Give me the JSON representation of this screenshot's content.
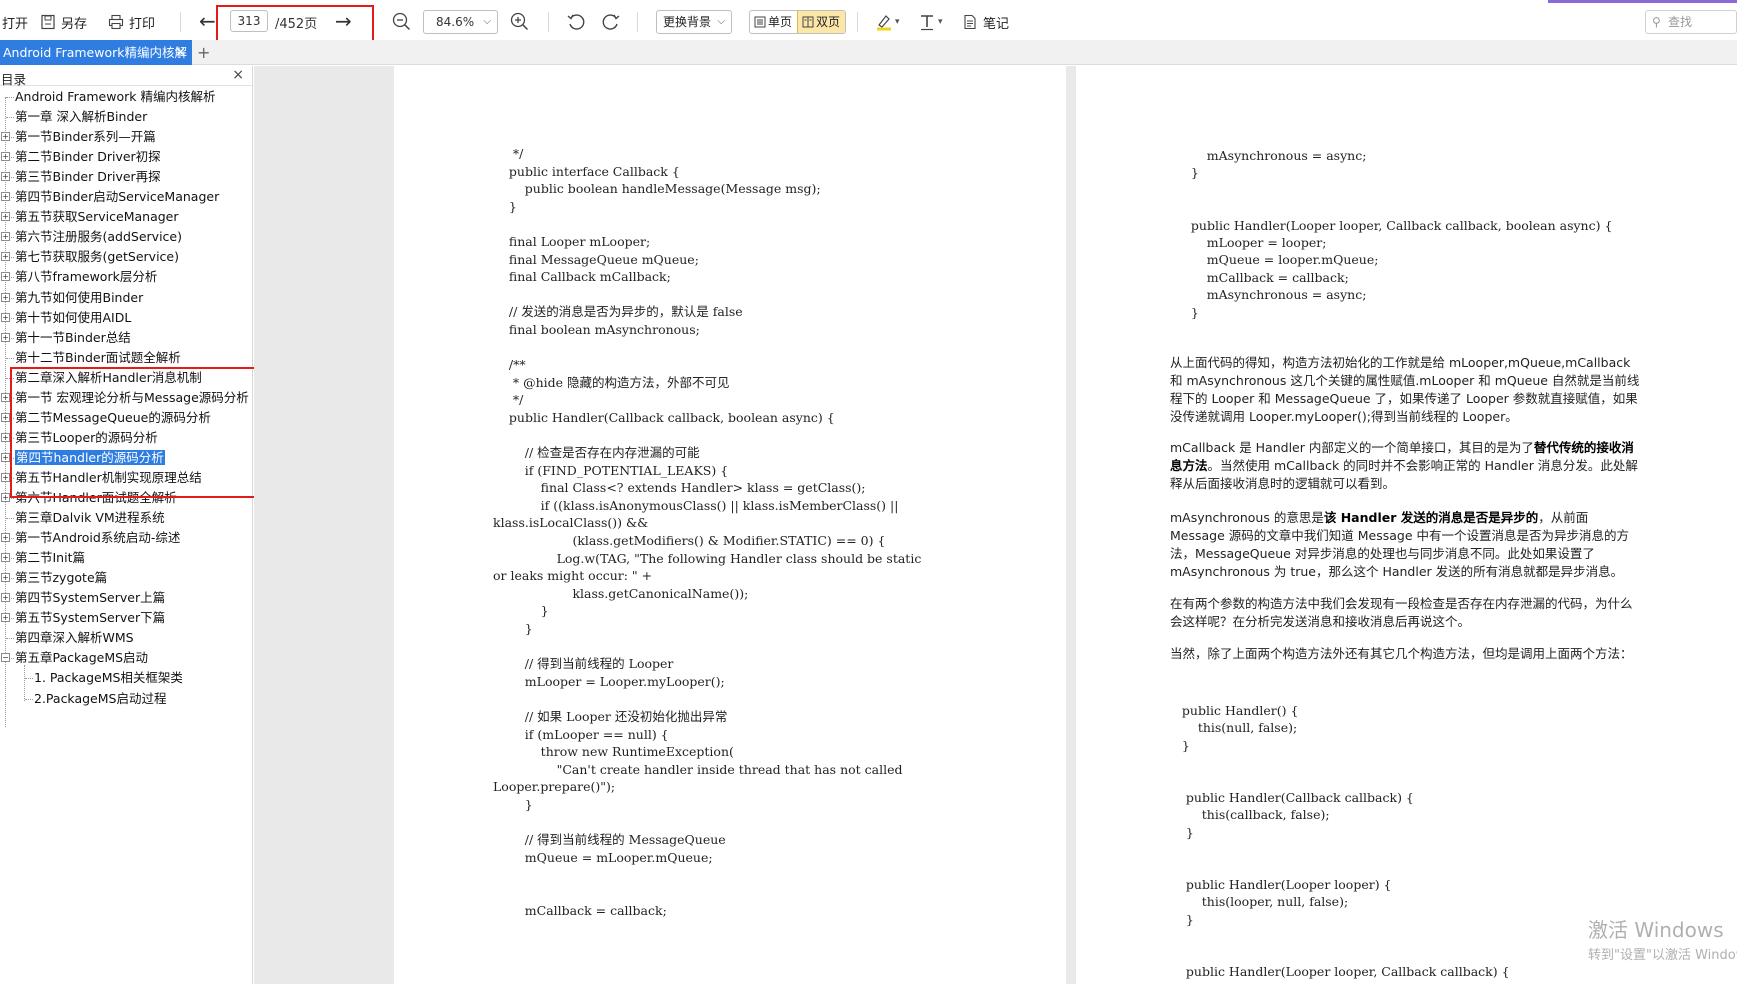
{
  "toolbar": {
    "open": "打开",
    "save_as": "另存",
    "print": "打印",
    "page_current": "313",
    "page_total": "/452页",
    "zoom": "84.6%",
    "background": "更换背景",
    "single_page": "单页",
    "double_page": "双页",
    "note": "笔记",
    "search_placeholder": "查找"
  },
  "tab": {
    "title": "Android Framework精编内核解",
    "close": "×",
    "add": "+"
  },
  "sidebar": {
    "title": "目录",
    "close": "×",
    "items": [
      "Android Framework 精编内核解析",
      "第一章 深入解析Binder",
      "第一节Binder系列—开篇",
      "第二节Binder Driver初探",
      "第三节Binder Driver再探",
      "第四节Binder启动ServiceManager",
      "第五节获取ServiceManager",
      "第六节注册服务(addService)",
      "第七节获取服务(getService)",
      "第八节framework层分析",
      "第九节如何使用Binder",
      "第十节如何使用AIDL",
      "第十一节Binder总结",
      "第十二节Binder面试题全解析",
      "第二章深入解析Handler消息机制",
      "第一节 宏观理论分析与Message源码分析",
      "第二节MessageQueue的源码分析",
      "第三节Looper的源码分析",
      "第四节handler的源码分析",
      "第五节Handler机制实现原理总结",
      "第六节Handler面试题全解析",
      "第三章Dalvik VM进程系统",
      "第一节Android系统启动-综述",
      "第二节Init篇",
      "第三节zygote篇",
      "第四节SystemServer上篇",
      "第五节SystemServer下篇",
      "第四章深入解析WMS",
      "第五章PackageMS启动",
      "1. PackageMS相关框架类",
      "2.PackageMS启动过程"
    ]
  },
  "page_left": {
    "lines": [
      "     */",
      "    public interface Callback {",
      "        public boolean handleMessage(Message msg);",
      "    }",
      "",
      "    final Looper mLooper;",
      "    final MessageQueue mQueue;",
      "    final Callback mCallback;",
      "",
      "    // 发送的消息是否为异步的，默认是 false",
      "    final boolean mAsynchronous;",
      "",
      "    /**",
      "     * @hide 隐藏的构造方法，外部不可见",
      "     */",
      "    public Handler(Callback callback, boolean async) {",
      "",
      "        // 检查是否存在内存泄漏的可能",
      "        if (FIND_POTENTIAL_LEAKS) {",
      "            final Class<? extends Handler> klass = getClass();",
      "            if ((klass.isAnonymousClass() || klass.isMemberClass() ||",
      "klass.isLocalClass()) &&",
      "                    (klass.getModifiers() & Modifier.STATIC) == 0) {",
      "                Log.w(TAG, \"The following Handler class should be static",
      "or leaks might occur: \" +",
      "                    klass.getCanonicalName());",
      "            }",
      "        }",
      "",
      "        // 得到当前线程的 Looper",
      "        mLooper = Looper.myLooper();",
      "",
      "        // 如果 Looper 还没初始化抛出异常",
      "        if (mLooper == null) {",
      "            throw new RuntimeException(",
      "                \"Can't create handler inside thread that has not called",
      "Looper.prepare()\");",
      "        }",
      "",
      "        // 得到当前线程的 MessageQueue",
      "        mQueue = mLooper.mQueue;",
      "",
      "",
      "        mCallback = callback;"
    ]
  },
  "page_right": {
    "code_top": [
      "        mAsynchronous = async;",
      "    }",
      "",
      "",
      "    public Handler(Looper looper, Callback callback, boolean async) {",
      "        mLooper = looper;",
      "        mQueue = looper.mQueue;",
      "        mCallback = callback;",
      "        mAsynchronous = async;",
      "    }"
    ],
    "para1": "从上面代码的得知，构造方法初始化的工作就是给 mLooper,mQueue,mCallback 和 mAsynchronous 这几个关键的属性赋值.mLooper 和 mQueue 自然就是当前线程下的 Looper 和 MessageQueue 了，如果传递了 Looper 参数就直接赋值，如果没传递就调用 Looper.myLooper();得到当前线程的 Looper。",
    "para2_a": "mCallback 是 Handler 内部定义的一个简单接口，其目的是为了",
    "para2_b": "替代传统的接收消息方法",
    "para2_c": "。当然使用 mCallback 的同时并不会影响正常的 Handler 消息分发。此处解释从后面接收消息时的逻辑就可以看到。",
    "para3_a": "mAsynchronous 的意思是",
    "para3_b": "该 Handler 发送的消息是否是异步的",
    "para3_c": "，从前面 Message 源码的文章中我们知道 Message 中有一个设置消息是否为异步消息的方法，MessageQueue 对异步消息的处理也与同步消息不同。此处如果设置了 mAsynchronous 为 true，那么这个 Handler 发送的所有消息就都是异步消息。",
    "para4": "在有两个参数的构造方法中我们会发现有一段检查是否存在内存泄漏的代码，为什么会这样呢？在分析完发送消息和接收消息后再说这个。",
    "para5": "当然，除了上面两个构造方法外还有其它几个构造方法，但均是调用上面两个方法：",
    "code_bottom": [
      "   public Handler() {",
      "       this(null, false);",
      "   }",
      "",
      "",
      "    public Handler(Callback callback) {",
      "        this(callback, false);",
      "    }",
      "",
      "",
      "    public Handler(Looper looper) {",
      "        this(looper, null, false);",
      "    }",
      "",
      "",
      "    public Handler(Looper looper, Callback callback) {"
    ]
  },
  "watermark": {
    "title": "激活 Windows",
    "subtitle": "转到\"设置\"以激活 Windows"
  }
}
